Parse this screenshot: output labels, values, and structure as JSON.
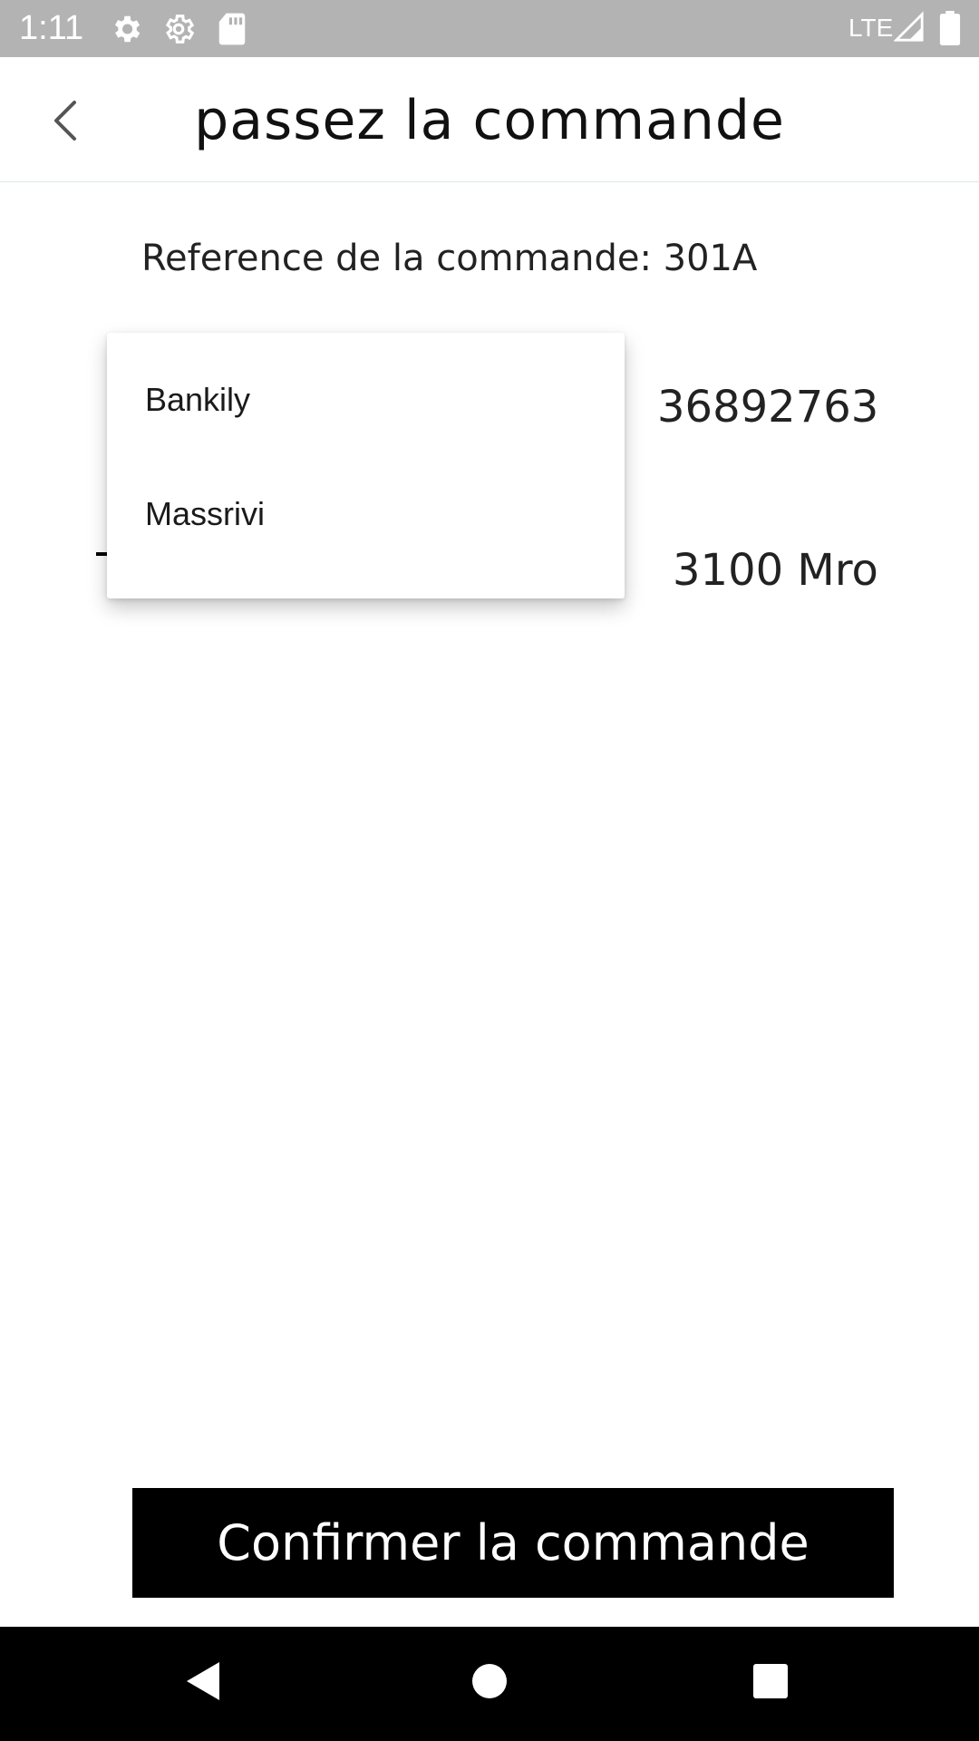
{
  "status_bar": {
    "time": "1:11",
    "network": "LTE",
    "icons": [
      "settings-icon",
      "settings-outline-icon",
      "sd-card-icon",
      "signal-icon",
      "battery-icon"
    ]
  },
  "app_bar": {
    "title": "passez la commande",
    "back_icon": "chevron-left-icon"
  },
  "content": {
    "order_reference": "Reference de la commande: 301A",
    "phone_number": "36892763",
    "amount": "3100 Mro"
  },
  "dropdown": {
    "options": [
      "Bankily",
      "Massrivi"
    ]
  },
  "actions": {
    "confirm_label": "Confirmer la commande"
  },
  "nav_bar": {
    "icons": [
      "nav-back-icon",
      "nav-home-icon",
      "nav-recents-icon"
    ]
  },
  "colors": {
    "status_bar": "#b3b3b3",
    "button_bg": "#000000",
    "button_text": "#ffffff",
    "nav_bar": "#000000"
  }
}
